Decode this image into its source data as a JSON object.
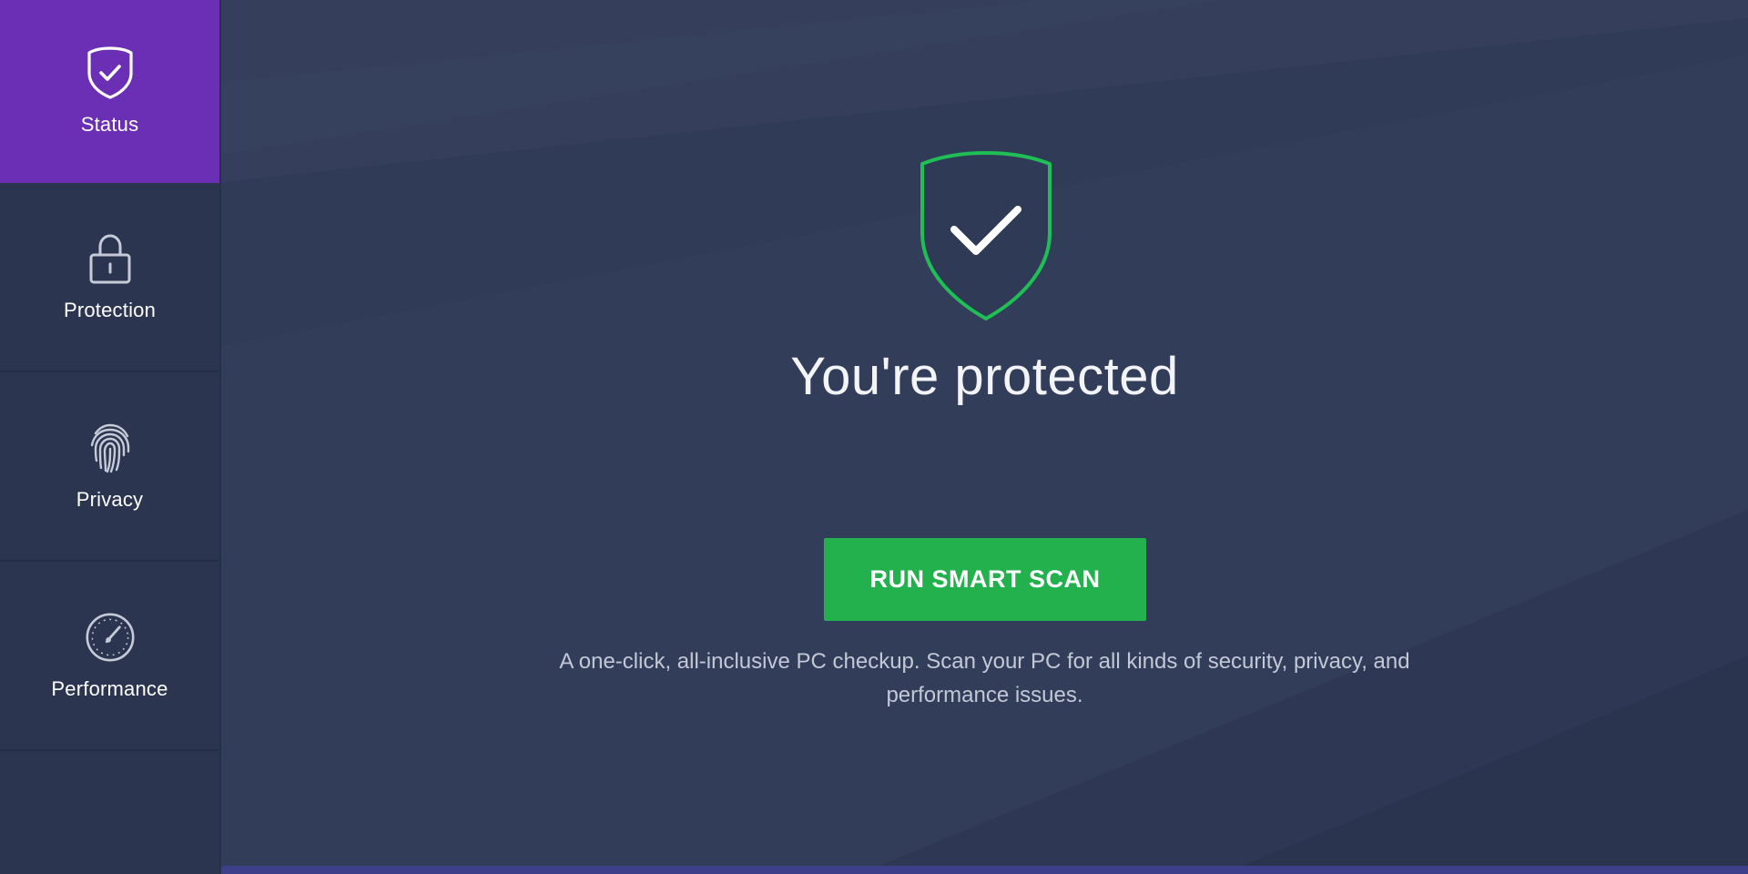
{
  "sidebar": {
    "items": [
      {
        "label": "Status",
        "icon": "shield-check-icon",
        "active": true
      },
      {
        "label": "Protection",
        "icon": "lock-icon",
        "active": false
      },
      {
        "label": "Privacy",
        "icon": "fingerprint-icon",
        "active": false
      },
      {
        "label": "Performance",
        "icon": "speedometer-icon",
        "active": false
      }
    ]
  },
  "main": {
    "status_icon": "shield-check-icon",
    "headline": "You're protected",
    "scan_button_label": "RUN SMART SCAN",
    "description_line1": "A one-click, all-inclusive PC checkup. Scan your PC for all kinds of security, privacy, and",
    "description_line2": "performance issues."
  },
  "colors": {
    "accent_purple": "#6a2fb5",
    "scan_green": "#22b14c",
    "shield_green": "#1fbf55",
    "background": "#323d59",
    "sidebar": "#2c3550"
  }
}
